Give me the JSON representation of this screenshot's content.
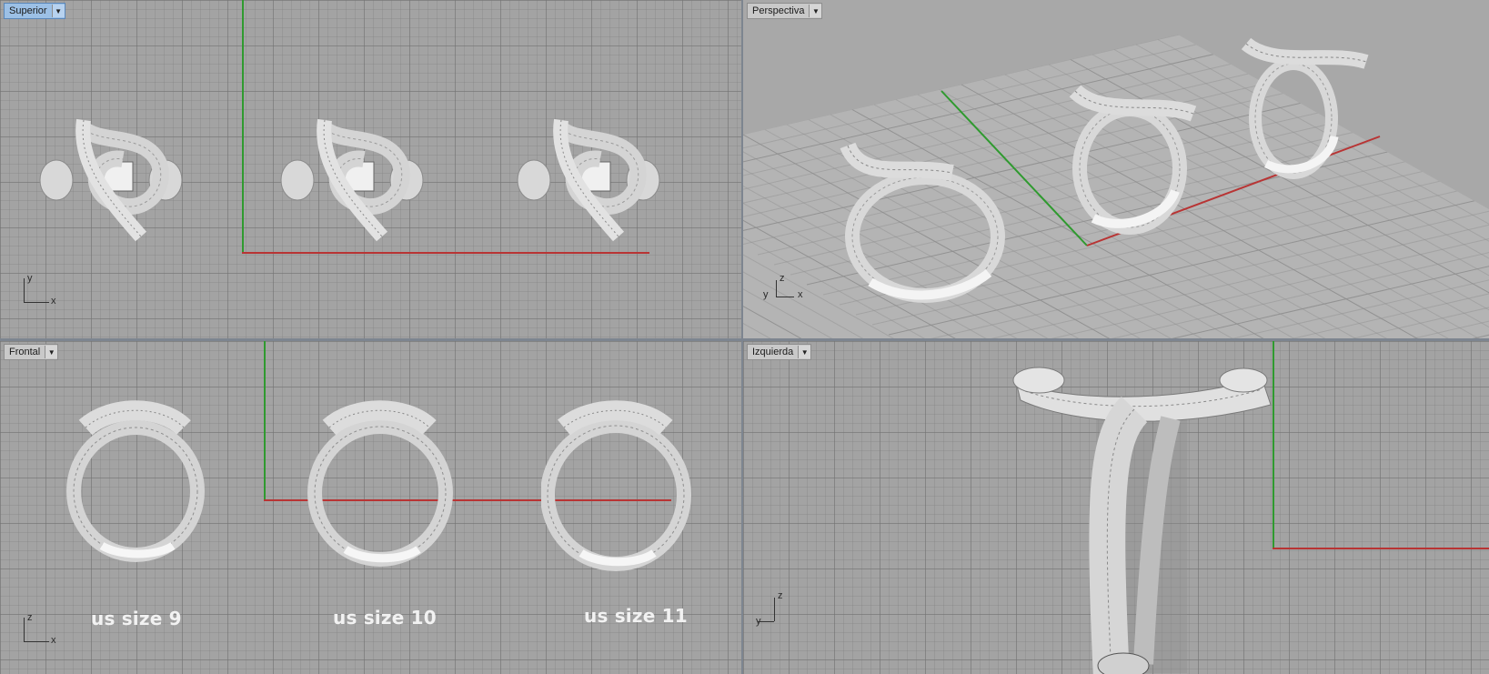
{
  "viewports": {
    "top": {
      "title": "Superior",
      "axis_x": "x",
      "axis_y": "y"
    },
    "persp": {
      "title": "Perspectiva",
      "axis_x": "x",
      "axis_y": "y",
      "axis_z": "z"
    },
    "front": {
      "title": "Frontal",
      "axis_x": "x",
      "axis_y": "z"
    },
    "left": {
      "title": "Izquierda",
      "axis_x": "y",
      "axis_y": "z"
    }
  },
  "size_labels": [
    "us size 9",
    "us size 10",
    "us size 11"
  ],
  "icons": {
    "dropdown": "dropdown-arrow-icon"
  },
  "colors": {
    "x_axis": "#b83434",
    "y_axis": "#2f9a2f",
    "active_title": "#9cc0e6"
  }
}
